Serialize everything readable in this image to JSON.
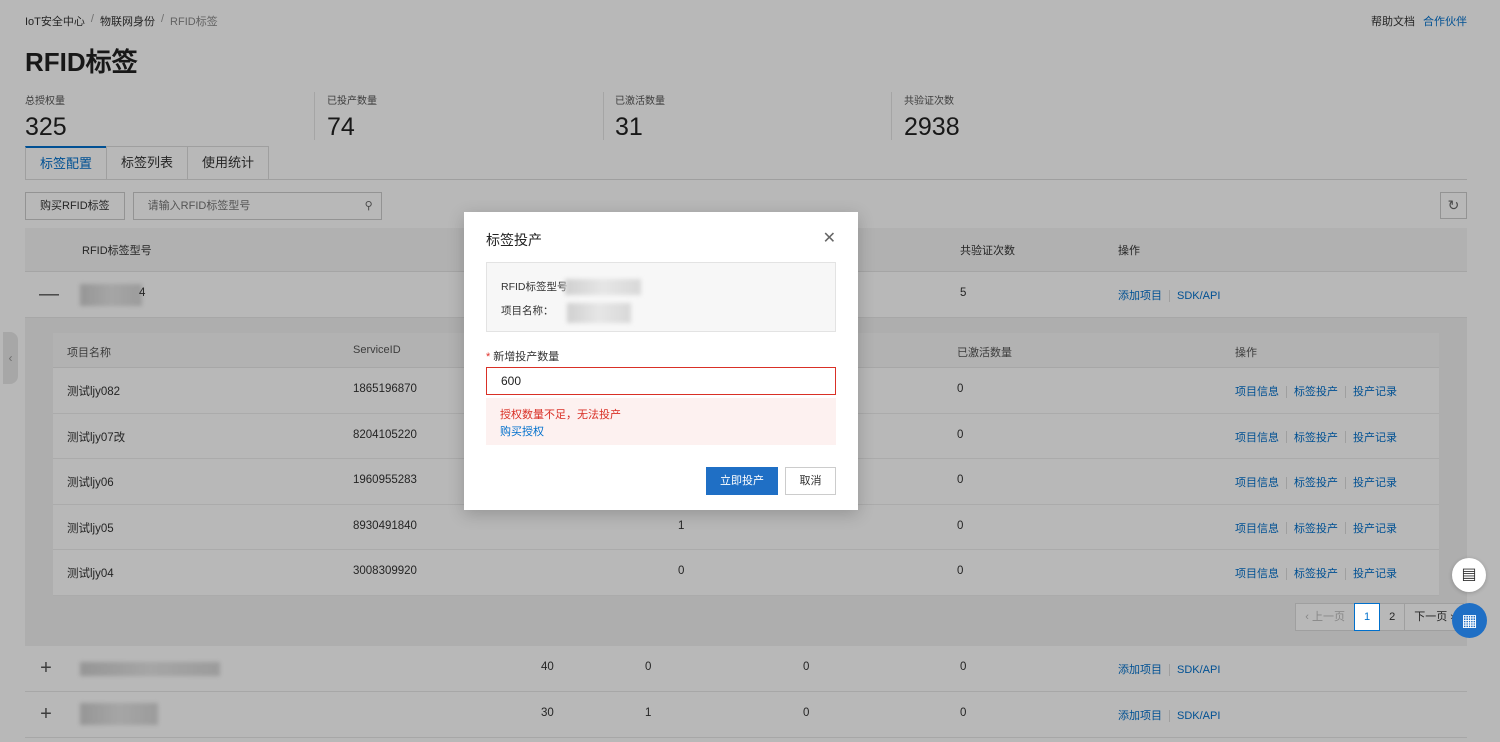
{
  "breadcrumb": {
    "items": [
      "IoT安全中心",
      "物联网身份",
      "RFID标签"
    ],
    "separator": "/"
  },
  "top_links": {
    "help": "帮助文档",
    "partner": "合作伙伴"
  },
  "page_title": "RFID标签",
  "stats": [
    {
      "label": "总授权量",
      "value": "325"
    },
    {
      "label": "已投产数量",
      "value": "74"
    },
    {
      "label": "已激活数量",
      "value": "31"
    },
    {
      "label": "共验证次数",
      "value": "2938"
    }
  ],
  "tabs": [
    "标签配置",
    "标签列表",
    "使用统计"
  ],
  "toolbar": {
    "buy_label": "购买RFID标签",
    "search_placeholder": "请输入RFID标签型号",
    "search_icon": "search-icon",
    "refresh_icon": "refresh-icon"
  },
  "main_table": {
    "headers": {
      "model": "RFID标签型号",
      "verify": "共验证次数",
      "ops": "操作"
    },
    "rows": [
      {
        "expander": "—",
        "model_suffix": "4",
        "total": "",
        "produced": "",
        "activated": "",
        "verify": "5",
        "ops": [
          "添加项目",
          "SDK/API"
        ]
      },
      {
        "expander": "+",
        "total": "40",
        "produced": "0",
        "activated": "0",
        "verify": "0",
        "ops": [
          "添加项目",
          "SDK/API"
        ]
      },
      {
        "expander": "+",
        "total": "30",
        "produced": "1",
        "activated": "0",
        "verify": "0",
        "ops": [
          "添加项目",
          "SDK/API"
        ]
      }
    ]
  },
  "sub_table": {
    "headers": {
      "name": "项目名称",
      "service": "ServiceID",
      "activated": "已激活数量",
      "ops": "操作"
    },
    "rows": [
      {
        "name": "测试ljy082",
        "service": "1865196870",
        "produced": "",
        "activated": "0"
      },
      {
        "name": "测试ljy07改",
        "service": "8204105220",
        "produced": "",
        "activated": "0"
      },
      {
        "name": "测试ljy06",
        "service": "1960955283",
        "produced": "",
        "activated": "0"
      },
      {
        "name": "测试ljy05",
        "service": "8930491840",
        "produced": "1",
        "activated": "0"
      },
      {
        "name": "测试ljy04",
        "service": "3008309920",
        "produced": "0",
        "activated": "0"
      }
    ],
    "ops": [
      "项目信息",
      "标签投产",
      "投产记录"
    ]
  },
  "pager": {
    "prev": "上一页",
    "pages": [
      "1",
      "2"
    ],
    "current": "1",
    "next": "下一页"
  },
  "modal": {
    "title": "标签投产",
    "info_model_label": "RFID标签型号：",
    "info_project_label": "项目名称：",
    "field_label": "新增投产数量",
    "required_mark": "*",
    "quantity_value": "600",
    "error_text": "授权数量不足，无法投产",
    "error_link": "购买授权",
    "confirm_label": "立即投产",
    "cancel_label": "取消",
    "close_icon": "close-icon"
  },
  "floating": {
    "chat_icon": "chat-icon",
    "apps_icon": "apps-grid-icon"
  },
  "colors": {
    "primary": "#1f6fc5",
    "error": "#d93026",
    "link": "#0070cc"
  }
}
